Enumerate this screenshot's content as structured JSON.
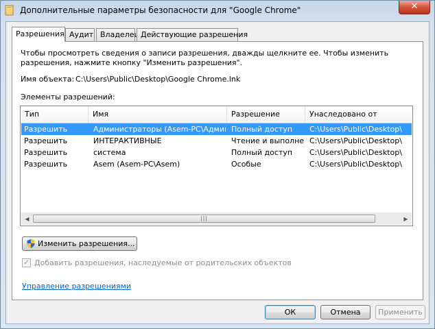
{
  "window": {
    "title": "Дополнительные параметры безопасности  для \"Google Chrome\"",
    "close_glyph": "✕"
  },
  "tabs": [
    {
      "label": "Разрешения",
      "active": true
    },
    {
      "label": "Аудит",
      "active": false
    },
    {
      "label": "Владелец",
      "active": false
    },
    {
      "label": "Действующие разрешения",
      "active": false
    }
  ],
  "permissions": {
    "info_text": "Чтобы просмотреть сведения о записи разрешения, дважды щелкните ее. Чтобы изменить разрешения, нажмите кнопку \"Изменить разрешения\".",
    "object_name_label": "Имя объекта:",
    "object_name_value": "C:\\Users\\Public\\Desktop\\Google Chrome.lnk",
    "entries_label": "Элементы разрешений:",
    "columns": [
      "Тип",
      "Имя",
      "Разрешение",
      "Унаследовано от"
    ],
    "rows": [
      {
        "type": "Разрешить",
        "name": "Администраторы (Asem-PC\\Админи...",
        "permission": "Полный доступ",
        "inherited": "C:\\Users\\Public\\Desktop\\",
        "selected": true
      },
      {
        "type": "Разрешить",
        "name": "ИНТЕРАКТИВНЫЕ",
        "permission": "Чтение и выполне...",
        "inherited": "C:\\Users\\Public\\Desktop\\",
        "selected": false
      },
      {
        "type": "Разрешить",
        "name": "система",
        "permission": "Полный доступ",
        "inherited": "C:\\Users\\Public\\Desktop\\",
        "selected": false
      },
      {
        "type": "Разрешить",
        "name": "Asem (Asem-PC\\Asem)",
        "permission": "Особые",
        "inherited": "C:\\Users\\Public\\Desktop\\",
        "selected": false
      }
    ],
    "change_button": "Изменить разрешения...",
    "inherit_checkbox_label": "Добавить разрешения, наследуемые от родительских объектов",
    "inherit_checked": true,
    "inherit_enabled": false,
    "manage_link": "Управление разрешениями"
  },
  "buttons": {
    "ok": "ОК",
    "cancel": "Отмена",
    "apply": "Применить"
  },
  "icons": {
    "title": "folder-shortcut-icon",
    "shield": "uac-shield-icon",
    "scroll_left": "◀",
    "scroll_right": "▶",
    "thumb_grip": "|||",
    "check": "✓"
  },
  "colors": {
    "selection": "#3399ff",
    "link": "#0066cc"
  }
}
